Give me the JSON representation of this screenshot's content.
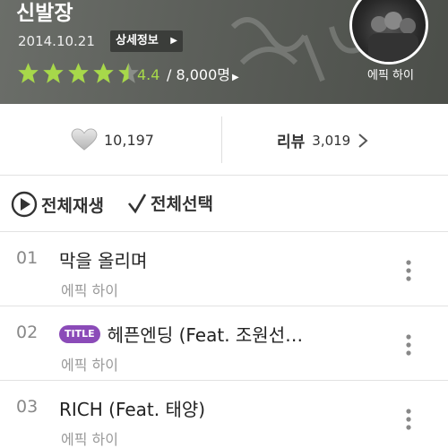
{
  "album": {
    "title": "신발장",
    "date": "2014.10.21",
    "detail_button": "상세정보",
    "rating_value": "4.4",
    "rating_count": "/ 8,000명",
    "rating_stars": 4.4,
    "star_color": "#a7d84a"
  },
  "artist": {
    "name": "에픽 하이"
  },
  "stats": {
    "like_count": "10,197",
    "review_label": "리뷰",
    "review_count": "3,019"
  },
  "actions": {
    "play_all_label": "전체재생",
    "select_all_label": "전체선택"
  },
  "tracks": [
    {
      "number": "01",
      "title": "막을 올리며",
      "artist": "에픽 하이",
      "badge": ""
    },
    {
      "number": "02",
      "title": "헤픈엔딩 (Feat. 조원선…",
      "artist": "에픽 하이",
      "badge": "TITLE"
    },
    {
      "number": "03",
      "title": "RICH (Feat. 태양)",
      "artist": "에픽 하이",
      "badge": ""
    }
  ],
  "icons": {
    "star": "star-icon",
    "heart": "heart-icon",
    "chevron": "chevron-right-icon",
    "play": "play-circle-icon",
    "check": "check-icon",
    "more": "more-vertical-icon"
  },
  "colors": {
    "header_bg": "#5d605b",
    "title_badge": "#8b4bb8",
    "accent_green": "#a7d84a"
  }
}
